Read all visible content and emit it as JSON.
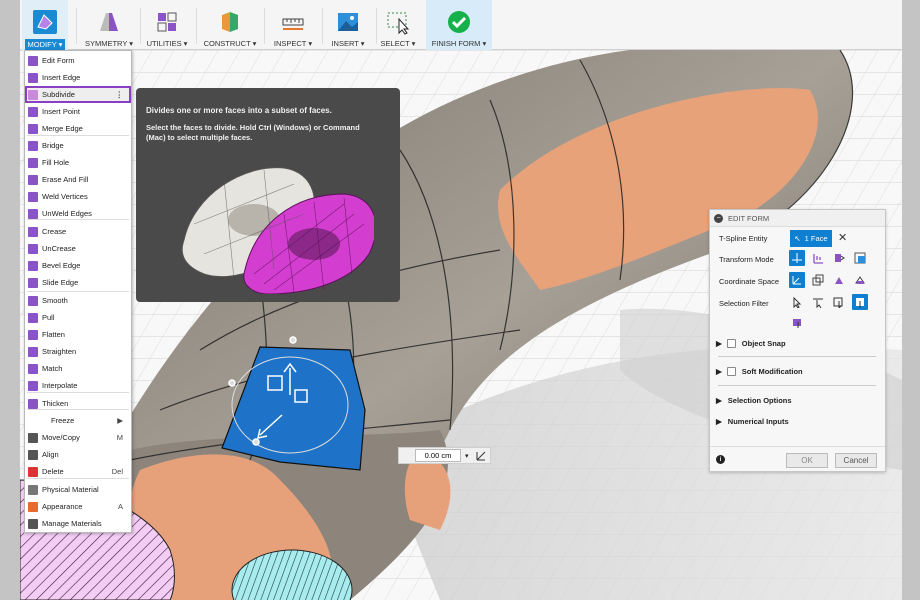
{
  "toolbar": {
    "modify": "MODIFY",
    "symmetry": "SYMMETRY",
    "utilities": "UTILITIES",
    "construct": "CONSTRUCT",
    "inspect": "INSPECT",
    "insert": "INSERT",
    "select": "SELECT",
    "finish_form": "FINISH FORM"
  },
  "menu": {
    "items": [
      {
        "label": "Edit Form",
        "icon": "edit-form-icon"
      },
      {
        "label": "Insert Edge",
        "icon": "insert-edge-icon"
      },
      {
        "label": "Subdivide",
        "icon": "subdivide-icon",
        "more": "⋮"
      },
      {
        "label": "Insert Point",
        "icon": "insert-point-icon"
      },
      {
        "label": "Merge Edge",
        "icon": "merge-edge-icon"
      },
      {
        "label": "Bridge",
        "icon": "bridge-icon"
      },
      {
        "label": "Fill Hole",
        "icon": "fill-hole-icon"
      },
      {
        "label": "Erase And Fill",
        "icon": "erase-fill-icon"
      },
      {
        "label": "Weld Vertices",
        "icon": "weld-vertices-icon"
      },
      {
        "label": "UnWeld Edges",
        "icon": "unweld-edges-icon"
      },
      {
        "label": "Crease",
        "icon": "crease-icon"
      },
      {
        "label": "UnCrease",
        "icon": "uncrease-icon"
      },
      {
        "label": "Bevel Edge",
        "icon": "bevel-edge-icon"
      },
      {
        "label": "Slide Edge",
        "icon": "slide-edge-icon"
      },
      {
        "label": "Smooth",
        "icon": "smooth-icon"
      },
      {
        "label": "Pull",
        "icon": "pull-icon"
      },
      {
        "label": "Flatten",
        "icon": "flatten-icon"
      },
      {
        "label": "Straighten",
        "icon": "straighten-icon"
      },
      {
        "label": "Match",
        "icon": "match-icon"
      },
      {
        "label": "Interpolate",
        "icon": "interpolate-icon"
      },
      {
        "label": "Thicken",
        "icon": "thicken-icon"
      },
      {
        "label": "Freeze",
        "arrow": "▶"
      },
      {
        "label": "Move/Copy",
        "icon": "move-copy-icon",
        "shortcut": "M"
      },
      {
        "label": "Align",
        "icon": "align-icon"
      },
      {
        "label": "Delete",
        "icon": "delete-icon",
        "shortcut": "Del"
      },
      {
        "label": "Physical Material",
        "icon": "physical-material-icon"
      },
      {
        "label": "Appearance",
        "icon": "appearance-icon",
        "shortcut": "A"
      },
      {
        "label": "Manage Materials",
        "icon": "manage-materials-icon"
      }
    ]
  },
  "tooltip": {
    "title": "Divides one or more faces into a subset of faces.",
    "description": "Select the faces to divide. Hold Ctrl (Windows) or Command (Mac) to select multiple faces."
  },
  "panel": {
    "title": "EDIT FORM",
    "tspline_label": "T-Spline Entity",
    "face_chip": "1 Face",
    "transform_label": "Transform Mode",
    "coord_label": "Coordinate Space",
    "selection_label": "Selection Filter",
    "object_snap": "Object Snap",
    "soft_mod": "Soft Modification",
    "selection_options": "Selection Options",
    "numerical_inputs": "Numerical Inputs",
    "ok": "OK",
    "cancel": "Cancel"
  },
  "distance_input": {
    "value": "0.00 cm"
  },
  "colors": {
    "accent": "#0e7fd1",
    "highlight": "#8a3fc2",
    "finish": "#16b14a",
    "skin": "#e8a27a",
    "body": "#8c8479",
    "selected_face": "#1e73c9",
    "magenta": "#d43ed0"
  }
}
